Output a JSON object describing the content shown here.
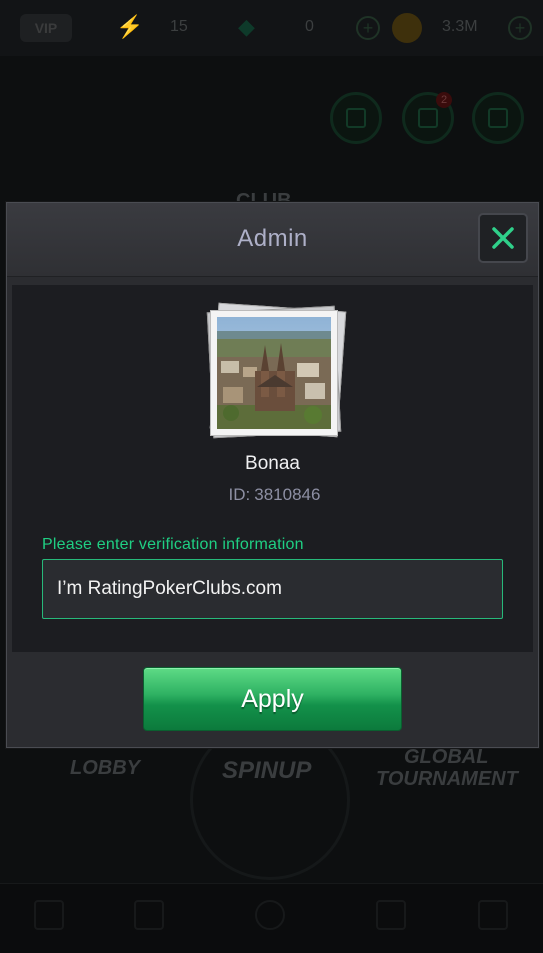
{
  "topbar": {
    "vip_label": "VIP",
    "energy": "15",
    "gems": "0",
    "coins": "3.3M"
  },
  "background": {
    "club_label": "CLUB",
    "lobby_label": "LOBBY",
    "spinup_label": "SPINUP",
    "global_label": "GLOBAL",
    "tournament_label": "TOURNAMENT",
    "notification_count": "2"
  },
  "modal": {
    "title": "Admin",
    "user_name": "Bonaa",
    "id_label": "ID:",
    "id_value": "3810846",
    "prompt": "Please enter verification information",
    "input_value": "I’m RatingPokerClubs.com",
    "apply_label": "Apply"
  },
  "colors": {
    "accent_green": "#1fcf83",
    "button_green": "#13914a",
    "title": "#aeb0c8"
  }
}
